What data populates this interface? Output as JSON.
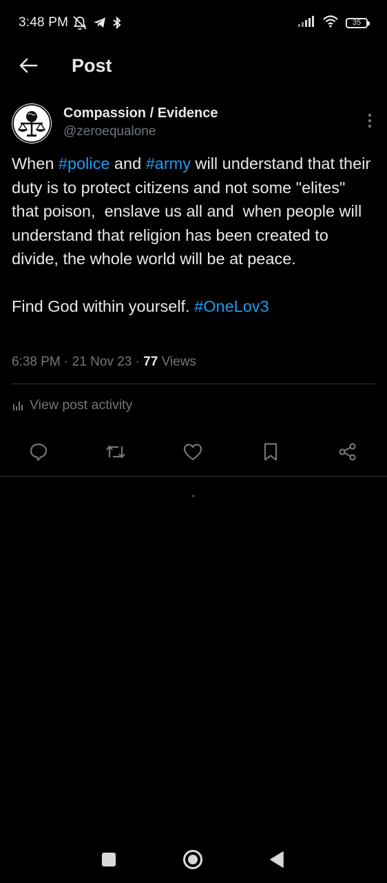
{
  "status_bar": {
    "time": "3:48 PM",
    "battery": "35",
    "icons": [
      "mute-bell-icon",
      "telegram-icon",
      "bluetooth-like-icon",
      "signal-icon",
      "wifi-icon",
      "battery-icon"
    ]
  },
  "header": {
    "title": "Post"
  },
  "post": {
    "author": {
      "display_name": "Compassion / Evidence",
      "handle": "@zeroequalone"
    },
    "text_parts": {
      "p1": "When ",
      "tag_police": "#police",
      "p2": " and ",
      "tag_army": "#army",
      "p3": " will understand that their duty is to protect citizens and not some \"elites\" that poison,  enslave us all and  when people will understand that religion has been created to divide, the whole world will be at peace.\n\nFind God within yourself. ",
      "tag_onelov3": "#OneLov3"
    },
    "meta": {
      "time": "6:38 PM",
      "sep1": " · ",
      "date": "21 Nov 23",
      "sep2": " · ",
      "views_count": "77",
      "views_label": " Views"
    },
    "activity_label": "View post activity"
  },
  "colors": {
    "background": "#000000",
    "text": "#e7e9ea",
    "secondary": "#71767b",
    "accent": "#1d9bf0",
    "divider": "#2f3336"
  }
}
